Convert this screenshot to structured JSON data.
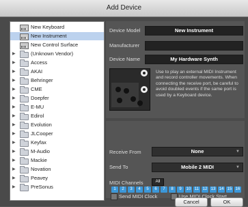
{
  "window": {
    "title": "Add Device"
  },
  "device_list": [
    {
      "label": "New Keyboard",
      "icon": "keyboard-icon",
      "selected": false,
      "expandable": false
    },
    {
      "label": "New Instrument",
      "icon": "keyboard-icon",
      "selected": true,
      "expandable": false
    },
    {
      "label": "New Control Surface",
      "icon": "control-surface-icon",
      "selected": false,
      "expandable": false
    },
    {
      "label": "(Unknown Vendor)",
      "icon": "folder-icon",
      "selected": false,
      "expandable": true
    },
    {
      "label": "Access",
      "icon": "folder-icon",
      "selected": false,
      "expandable": true
    },
    {
      "label": "AKAI",
      "icon": "folder-icon",
      "selected": false,
      "expandable": true
    },
    {
      "label": "Behringer",
      "icon": "folder-icon",
      "selected": false,
      "expandable": true
    },
    {
      "label": "CME",
      "icon": "folder-icon",
      "selected": false,
      "expandable": true
    },
    {
      "label": "Doepfer",
      "icon": "folder-icon",
      "selected": false,
      "expandable": true
    },
    {
      "label": "E-MU",
      "icon": "folder-icon",
      "selected": false,
      "expandable": true
    },
    {
      "label": "Edirol",
      "icon": "folder-icon",
      "selected": false,
      "expandable": true
    },
    {
      "label": "Evolution",
      "icon": "folder-icon",
      "selected": false,
      "expandable": true
    },
    {
      "label": "JLCooper",
      "icon": "folder-icon",
      "selected": false,
      "expandable": true
    },
    {
      "label": "Keyfax",
      "icon": "folder-icon",
      "selected": false,
      "expandable": true
    },
    {
      "label": "M-Audio",
      "icon": "folder-icon",
      "selected": false,
      "expandable": true
    },
    {
      "label": "Mackie",
      "icon": "folder-icon",
      "selected": false,
      "expandable": true
    },
    {
      "label": "Novation",
      "icon": "folder-icon",
      "selected": false,
      "expandable": true
    },
    {
      "label": "Peavey",
      "icon": "folder-icon",
      "selected": false,
      "expandable": true
    },
    {
      "label": "PreSonus",
      "icon": "folder-icon",
      "selected": false,
      "expandable": true
    }
  ],
  "device": {
    "model_label": "Device Model",
    "model_value": "New Instrument",
    "manufacturer_label": "Manufacturer",
    "manufacturer_value": "",
    "name_label": "Device Name",
    "name_value": "My Hardware Synth",
    "description": "Use to play an external MIDI Instrument and record controller movements. When connecting the receive port, be careful to avoid doubled events if the same port is used by a Keyboard device."
  },
  "routing": {
    "receive_label": "Receive From",
    "receive_value": "None",
    "send_label": "Send To",
    "send_value": "Mobile 2 MIDI",
    "channels_label": "MIDI Channels",
    "all_label": "All",
    "channels": [
      "1",
      "2",
      "3",
      "4",
      "5",
      "6",
      "7",
      "8",
      "9",
      "10",
      "11",
      "12",
      "13",
      "14",
      "15",
      "16"
    ],
    "send_clock_label": "Send MIDI Clock",
    "clock_start_label": "Use MIDI Clock Start"
  },
  "buttons": {
    "cancel": "Cancel",
    "ok": "OK"
  },
  "colors": {
    "channel_active": "#3b97d8",
    "selection": "#bcd2ee"
  }
}
